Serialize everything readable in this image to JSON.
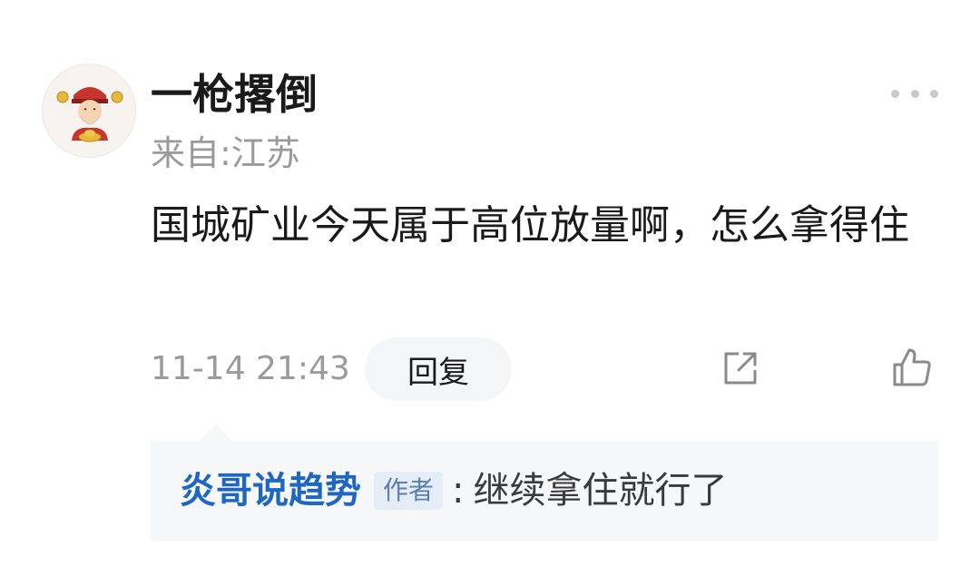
{
  "comment": {
    "username": "一枪撂倒",
    "location": "来自:江苏",
    "text": "国城矿业今天属于高位放量啊，怎么拿得住",
    "timestamp": "11-14 21:43",
    "reply_label": "回复",
    "more_icon": "more-icon",
    "share_icon": "share-icon",
    "like_icon": "thumbs-up-icon"
  },
  "reply": {
    "author": "炎哥说趋势",
    "author_tag": "作者",
    "separator": ":",
    "text": "继续拿住就行了"
  },
  "colors": {
    "author_link": "#1f65c2",
    "muted": "#9a9a9a",
    "reply_bg": "#f6f7f9"
  }
}
